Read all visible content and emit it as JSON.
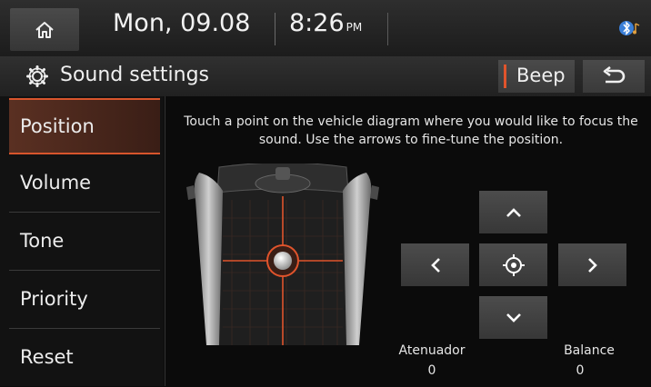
{
  "status": {
    "date": "Mon, 09.08",
    "time": "8:26",
    "ampm": "PM"
  },
  "header": {
    "title": "Sound settings",
    "beep_label": "Beep"
  },
  "sidebar": {
    "items": [
      {
        "label": "Position"
      },
      {
        "label": "Volume"
      },
      {
        "label": "Tone"
      },
      {
        "label": "Priority"
      },
      {
        "label": "Reset"
      }
    ]
  },
  "main": {
    "instruction": "Touch a point on the vehicle diagram where you would like to focus the sound. Use the arrows to fine-tune the position.",
    "fader_label": "Atenuador",
    "fader_value": "0",
    "balance_label": "Balance",
    "balance_value": "0"
  },
  "colors": {
    "accent": "#d8552c",
    "background": "#0b0b0b",
    "button": "#404040"
  },
  "icons": [
    "home-icon",
    "bluetooth-icon",
    "gear-icon",
    "back-icon",
    "chevron-up-icon",
    "chevron-down-icon",
    "chevron-left-icon",
    "chevron-right-icon",
    "crosshair-icon"
  ]
}
